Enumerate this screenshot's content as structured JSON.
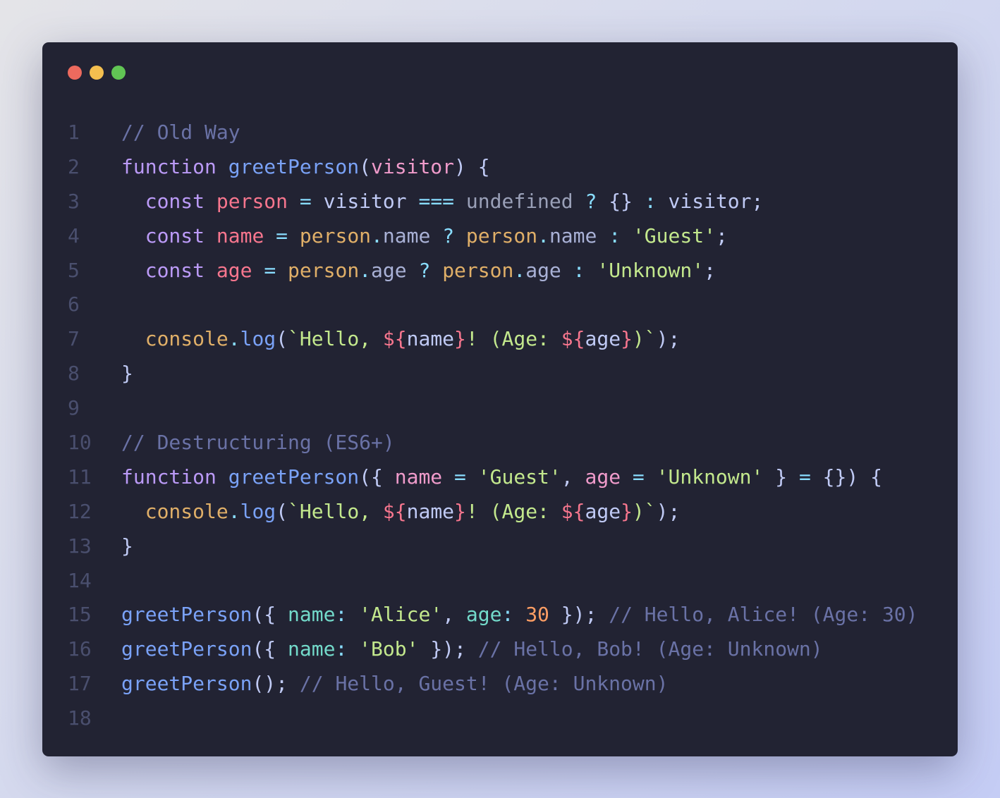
{
  "window": {
    "controls": [
      {
        "name": "close-button",
        "color": "#ed6a5e"
      },
      {
        "name": "minimize-button",
        "color": "#f4bf4f"
      },
      {
        "name": "maximize-button",
        "color": "#61c554"
      }
    ]
  },
  "code": {
    "lines": [
      {
        "number": "1",
        "tokens": [
          [
            "// Old Way",
            "c"
          ]
        ]
      },
      {
        "number": "2",
        "tokens": [
          [
            "function",
            "k"
          ],
          [
            " ",
            "t"
          ],
          [
            "greetPerson",
            "f"
          ],
          [
            "(",
            "t"
          ],
          [
            "visitor",
            "p"
          ],
          [
            ") {",
            "t"
          ]
        ]
      },
      {
        "number": "3",
        "tokens": [
          [
            "  ",
            "t"
          ],
          [
            "const",
            "k"
          ],
          [
            " ",
            "t"
          ],
          [
            "person",
            "v"
          ],
          [
            " ",
            "t"
          ],
          [
            "=",
            "o"
          ],
          [
            " visitor ",
            "t"
          ],
          [
            "===",
            "o"
          ],
          [
            " ",
            "t"
          ],
          [
            "undefined",
            "u"
          ],
          [
            " ",
            "t"
          ],
          [
            "?",
            "o"
          ],
          [
            " {} ",
            "t"
          ],
          [
            ":",
            "o"
          ],
          [
            " visitor;",
            "t"
          ]
        ]
      },
      {
        "number": "4",
        "tokens": [
          [
            "  ",
            "t"
          ],
          [
            "const",
            "k"
          ],
          [
            " ",
            "t"
          ],
          [
            "name",
            "v"
          ],
          [
            " ",
            "t"
          ],
          [
            "=",
            "o"
          ],
          [
            " ",
            "t"
          ],
          [
            "person",
            "y"
          ],
          [
            ".",
            "o"
          ],
          [
            "name",
            "m"
          ],
          [
            " ",
            "t"
          ],
          [
            "?",
            "o"
          ],
          [
            " ",
            "t"
          ],
          [
            "person",
            "y"
          ],
          [
            ".",
            "o"
          ],
          [
            "name",
            "m"
          ],
          [
            " ",
            "t"
          ],
          [
            ":",
            "o"
          ],
          [
            " ",
            "t"
          ],
          [
            "'Guest'",
            "s"
          ],
          [
            ";",
            "t"
          ]
        ]
      },
      {
        "number": "5",
        "tokens": [
          [
            "  ",
            "t"
          ],
          [
            "const",
            "k"
          ],
          [
            " ",
            "t"
          ],
          [
            "age",
            "v"
          ],
          [
            " ",
            "t"
          ],
          [
            "=",
            "o"
          ],
          [
            " ",
            "t"
          ],
          [
            "person",
            "y"
          ],
          [
            ".",
            "o"
          ],
          [
            "age",
            "m"
          ],
          [
            " ",
            "t"
          ],
          [
            "?",
            "o"
          ],
          [
            " ",
            "t"
          ],
          [
            "person",
            "y"
          ],
          [
            ".",
            "o"
          ],
          [
            "age",
            "m"
          ],
          [
            " ",
            "t"
          ],
          [
            ":",
            "o"
          ],
          [
            " ",
            "t"
          ],
          [
            "'Unknown'",
            "s"
          ],
          [
            ";",
            "t"
          ]
        ]
      },
      {
        "number": "6",
        "tokens": []
      },
      {
        "number": "7",
        "tokens": [
          [
            "  ",
            "t"
          ],
          [
            "console",
            "y"
          ],
          [
            ".",
            "o"
          ],
          [
            "log",
            "f"
          ],
          [
            "(",
            "t"
          ],
          [
            "`Hello, ",
            "s"
          ],
          [
            "${",
            "i"
          ],
          [
            "name",
            "t"
          ],
          [
            "}",
            "i"
          ],
          [
            "! (Age: ",
            "s"
          ],
          [
            "${",
            "i"
          ],
          [
            "age",
            "t"
          ],
          [
            "}",
            "i"
          ],
          [
            ")`",
            "s"
          ],
          [
            ");",
            "t"
          ]
        ]
      },
      {
        "number": "8",
        "tokens": [
          [
            "}",
            "t"
          ]
        ]
      },
      {
        "number": "9",
        "tokens": []
      },
      {
        "number": "10",
        "tokens": [
          [
            "// Destructuring (ES6+)",
            "c"
          ]
        ]
      },
      {
        "number": "11",
        "tokens": [
          [
            "function",
            "k"
          ],
          [
            " ",
            "t"
          ],
          [
            "greetPerson",
            "f"
          ],
          [
            "({ ",
            "t"
          ],
          [
            "name",
            "p"
          ],
          [
            " ",
            "t"
          ],
          [
            "=",
            "o"
          ],
          [
            " ",
            "t"
          ],
          [
            "'Guest'",
            "s"
          ],
          [
            ", ",
            "t"
          ],
          [
            "age",
            "p"
          ],
          [
            " ",
            "t"
          ],
          [
            "=",
            "o"
          ],
          [
            " ",
            "t"
          ],
          [
            "'Unknown'",
            "s"
          ],
          [
            " } ",
            "t"
          ],
          [
            "=",
            "o"
          ],
          [
            " {}) {",
            "t"
          ]
        ]
      },
      {
        "number": "12",
        "tokens": [
          [
            "  ",
            "t"
          ],
          [
            "console",
            "y"
          ],
          [
            ".",
            "o"
          ],
          [
            "log",
            "f"
          ],
          [
            "(",
            "t"
          ],
          [
            "`Hello, ",
            "s"
          ],
          [
            "${",
            "i"
          ],
          [
            "name",
            "t"
          ],
          [
            "}",
            "i"
          ],
          [
            "! (Age: ",
            "s"
          ],
          [
            "${",
            "i"
          ],
          [
            "age",
            "t"
          ],
          [
            "}",
            "i"
          ],
          [
            ")`",
            "s"
          ],
          [
            ");",
            "t"
          ]
        ]
      },
      {
        "number": "13",
        "tokens": [
          [
            "}",
            "t"
          ]
        ]
      },
      {
        "number": "14",
        "tokens": []
      },
      {
        "number": "15",
        "tokens": [
          [
            "greetPerson",
            "f"
          ],
          [
            "({ ",
            "t"
          ],
          [
            "name",
            "pr"
          ],
          [
            ":",
            "o"
          ],
          [
            " ",
            "t"
          ],
          [
            "'Alice'",
            "s"
          ],
          [
            ", ",
            "t"
          ],
          [
            "age",
            "pr"
          ],
          [
            ":",
            "o"
          ],
          [
            " ",
            "t"
          ],
          [
            "30",
            "n"
          ],
          [
            " }); ",
            "t"
          ],
          [
            "// Hello, Alice! (Age: 30)",
            "c"
          ]
        ]
      },
      {
        "number": "16",
        "tokens": [
          [
            "greetPerson",
            "f"
          ],
          [
            "({ ",
            "t"
          ],
          [
            "name",
            "pr"
          ],
          [
            ":",
            "o"
          ],
          [
            " ",
            "t"
          ],
          [
            "'Bob'",
            "s"
          ],
          [
            " }); ",
            "t"
          ],
          [
            "// Hello, Bob! (Age: Unknown)",
            "c"
          ]
        ]
      },
      {
        "number": "17",
        "tokens": [
          [
            "greetPerson",
            "f"
          ],
          [
            "(); ",
            "t"
          ],
          [
            "// Hello, Guest! (Age: Unknown)",
            "c"
          ]
        ]
      },
      {
        "number": "18",
        "tokens": []
      }
    ]
  }
}
